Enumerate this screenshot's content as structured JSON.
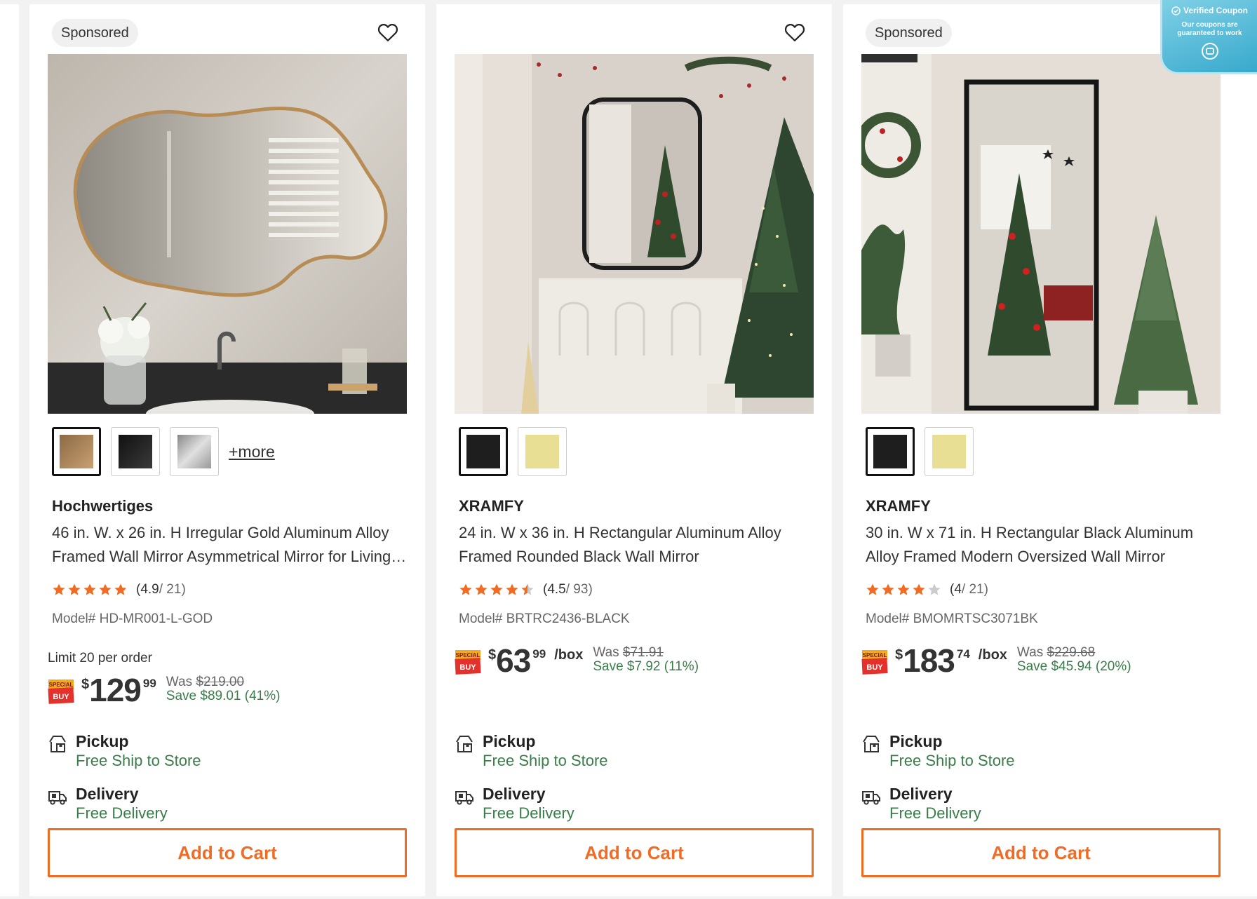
{
  "colors": {
    "accent_orange": "#f06c25",
    "savings_green": "#3b7d4a",
    "star_orange": "#f06c25",
    "star_empty": "#cccccc",
    "coupon_blue": "#38a9cc"
  },
  "coupon_badge": {
    "title": "Verified Coupon",
    "text": "Our coupons are guaranteed to work",
    "icon": "coupon-circle-icon"
  },
  "products": [
    {
      "sponsored": "Sponsored",
      "favorite_icon": "heart-icon",
      "image": "irregular-gold-mirror-bathroom",
      "swatches": [
        "#b08a5c",
        "#1e1e1e",
        "#a8a8a8"
      ],
      "more_label": "+more",
      "brand": "Hochwertiges",
      "title": "46 in. W. x 26 in. H Irregular Gold Aluminum Alloy Framed Wall Mirror Asymmetrical Mirror for Living Room",
      "rating": 4.9,
      "rating_text": "(4.9",
      "rating_count": " / 21)",
      "model": "Model# HD-MR001-L-GOD",
      "limit": "Limit 20 per order",
      "price_symbol": "$",
      "price_dollars": "129",
      "price_cents": "99",
      "price_unit": "",
      "was_label": "Was ",
      "was_price": "$219.00",
      "save": "Save $89.01 (41%)",
      "pickup_title": "Pickup",
      "pickup_sub": "Free Ship to Store",
      "delivery_title": "Delivery",
      "delivery_sub": "Free Delivery",
      "add_to_cart": "Add to Cart"
    },
    {
      "sponsored": "",
      "favorite_icon": "heart-icon",
      "image": "rectangular-black-mirror-christmas",
      "swatches": [
        "#1e1e1e",
        "#e8df95"
      ],
      "more_label": "",
      "brand": "XRAMFY",
      "title": "24 in. W x 36 in. H Rectangular Aluminum Alloy Framed Rounded Black Wall Mirror",
      "rating": 4.5,
      "rating_text": "(4.5",
      "rating_count": " / 93)",
      "model": "Model# BRTRC2436-BLACK",
      "limit": "",
      "price_symbol": "$",
      "price_dollars": "63",
      "price_cents": "99",
      "price_unit": "/box",
      "was_label": "Was ",
      "was_price": "$71.91",
      "save": "Save $7.92 (11%)",
      "pickup_title": "Pickup",
      "pickup_sub": "Free Ship to Store",
      "delivery_title": "Delivery",
      "delivery_sub": "Free Delivery",
      "add_to_cart": "Add to Cart"
    },
    {
      "sponsored": "Sponsored",
      "favorite_icon": "heart-icon",
      "image": "oversized-black-floor-mirror",
      "swatches": [
        "#1e1e1e",
        "#e8df95"
      ],
      "more_label": "",
      "brand": "XRAMFY",
      "title": "30 in. W x 71 in. H Rectangular Black Aluminum Alloy Framed Modern Oversized Wall Mirror",
      "rating": 4,
      "rating_text": "(4",
      "rating_count": " / 21)",
      "model": "Model# BMOMRTSC3071BK",
      "limit": "",
      "price_symbol": "$",
      "price_dollars": "183",
      "price_cents": "74",
      "price_unit": "/box",
      "was_label": "Was ",
      "was_price": "$229.68",
      "save": "Save $45.94 (20%)",
      "pickup_title": "Pickup",
      "pickup_sub": "Free Ship to Store",
      "delivery_title": "Delivery",
      "delivery_sub": "Free Delivery",
      "add_to_cart": "Add to Cart"
    }
  ]
}
